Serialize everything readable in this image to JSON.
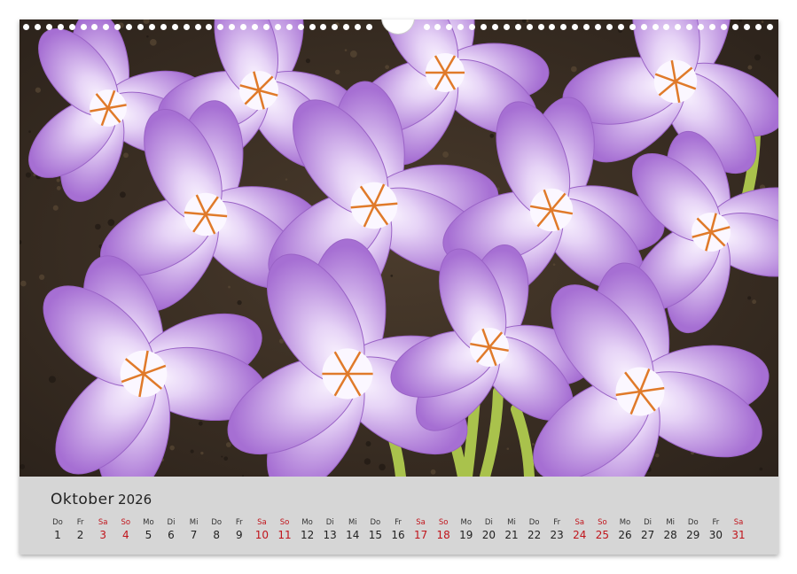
{
  "calendar": {
    "month": "Oktober",
    "year": "2026",
    "weekend_color": "#c0141b",
    "days": [
      {
        "wd": "Do",
        "d": "1",
        "we": false
      },
      {
        "wd": "Fr",
        "d": "2",
        "we": false
      },
      {
        "wd": "Sa",
        "d": "3",
        "we": true
      },
      {
        "wd": "So",
        "d": "4",
        "we": true
      },
      {
        "wd": "Mo",
        "d": "5",
        "we": false
      },
      {
        "wd": "Di",
        "d": "6",
        "we": false
      },
      {
        "wd": "Mi",
        "d": "7",
        "we": false
      },
      {
        "wd": "Do",
        "d": "8",
        "we": false
      },
      {
        "wd": "Fr",
        "d": "9",
        "we": false
      },
      {
        "wd": "Sa",
        "d": "10",
        "we": true
      },
      {
        "wd": "So",
        "d": "11",
        "we": true
      },
      {
        "wd": "Mo",
        "d": "12",
        "we": false
      },
      {
        "wd": "Di",
        "d": "13",
        "we": false
      },
      {
        "wd": "Mi",
        "d": "14",
        "we": false
      },
      {
        "wd": "Do",
        "d": "15",
        "we": false
      },
      {
        "wd": "Fr",
        "d": "16",
        "we": false
      },
      {
        "wd": "Sa",
        "d": "17",
        "we": true
      },
      {
        "wd": "So",
        "d": "18",
        "we": true
      },
      {
        "wd": "Mo",
        "d": "19",
        "we": false
      },
      {
        "wd": "Di",
        "d": "20",
        "we": false
      },
      {
        "wd": "Mi",
        "d": "21",
        "we": false
      },
      {
        "wd": "Do",
        "d": "22",
        "we": false
      },
      {
        "wd": "Fr",
        "d": "23",
        "we": false
      },
      {
        "wd": "Sa",
        "d": "24",
        "we": true
      },
      {
        "wd": "So",
        "d": "25",
        "we": true
      },
      {
        "wd": "Mo",
        "d": "26",
        "we": false
      },
      {
        "wd": "Di",
        "d": "27",
        "we": false
      },
      {
        "wd": "Mi",
        "d": "28",
        "we": false
      },
      {
        "wd": "Do",
        "d": "29",
        "we": false
      },
      {
        "wd": "Fr",
        "d": "30",
        "we": false
      },
      {
        "wd": "Sa",
        "d": "31",
        "we": true
      }
    ]
  },
  "photo": {
    "subject": "purple-crocus-flowers",
    "colors": {
      "petal": "#b985dc",
      "petal_light": "#e9dcf5",
      "soil": "#3a2f24",
      "stamen": "#e07a2a",
      "stem": "#a7c24a"
    }
  }
}
